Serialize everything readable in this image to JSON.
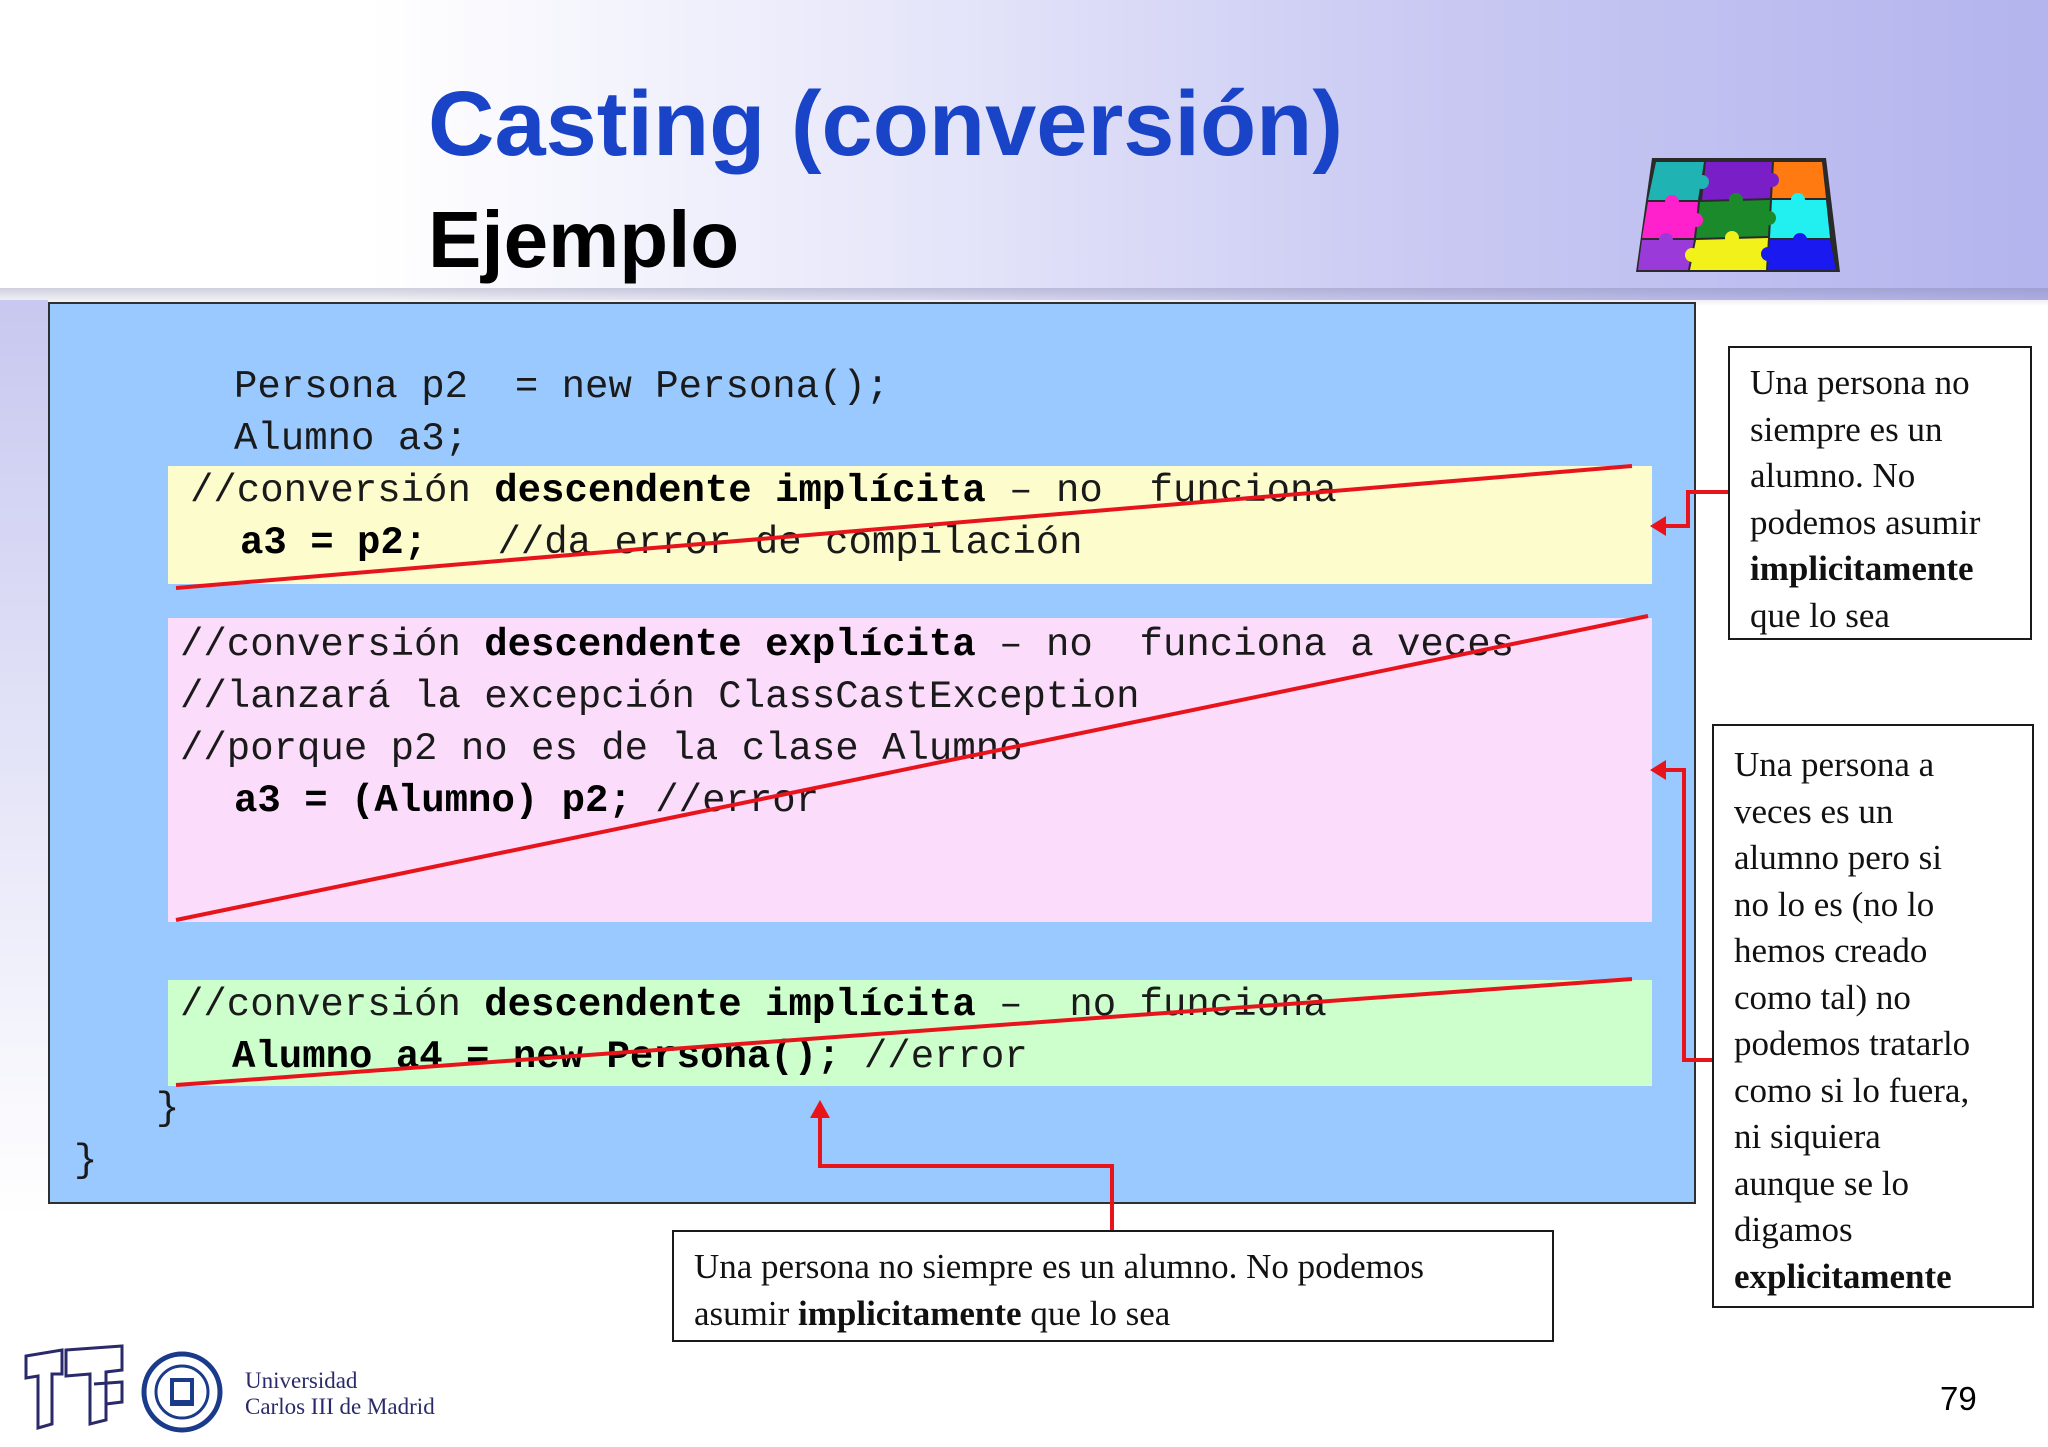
{
  "slide": {
    "title": "Casting (conversión)",
    "subtitle": "Ejemplo",
    "page_number": "79"
  },
  "code": {
    "lines": [
      {
        "id": "l1",
        "parts": [
          {
            "t": "Persona p2  = new Persona();",
            "b": false
          }
        ]
      },
      {
        "id": "l2",
        "parts": [
          {
            "t": "Alumno a3;",
            "b": false
          }
        ]
      },
      {
        "id": "l3",
        "parts": [
          {
            "t": "//conversión ",
            "b": false
          },
          {
            "t": "descendente implícita",
            "b": true
          },
          {
            "t": " – no  funciona",
            "b": false
          }
        ]
      },
      {
        "id": "l4",
        "parts": [
          {
            "t": "a3 = p2;",
            "b": true
          },
          {
            "t": "   //da error de compilación",
            "b": false
          }
        ]
      },
      {
        "id": "l5",
        "parts": [
          {
            "t": "//conversión ",
            "b": false
          },
          {
            "t": "descendente explícita",
            "b": true
          },
          {
            "t": " – no  funciona a veces",
            "b": false
          }
        ]
      },
      {
        "id": "l6",
        "parts": [
          {
            "t": "//lanzará la excepción ClassCastException",
            "b": false
          }
        ]
      },
      {
        "id": "l7",
        "parts": [
          {
            "t": "//porque p2 no es de la clase Alumno",
            "b": false
          }
        ]
      },
      {
        "id": "l8",
        "parts": [
          {
            "t": "a3 = (Alumno) p2;",
            "b": true
          },
          {
            "t": " //error",
            "b": false
          }
        ]
      },
      {
        "id": "l9",
        "parts": [
          {
            "t": "//conversión ",
            "b": false
          },
          {
            "t": "descendente implícita",
            "b": true
          },
          {
            "t": " –  no funciona",
            "b": false
          }
        ]
      },
      {
        "id": "l10",
        "parts": [
          {
            "t": "Alumno a4 = new Persona();",
            "b": true
          },
          {
            "t": " //error",
            "b": false
          }
        ]
      },
      {
        "id": "l11",
        "parts": [
          {
            "t": "}",
            "b": false
          }
        ]
      },
      {
        "id": "l12",
        "parts": [
          {
            "t": "}",
            "b": false
          }
        ]
      }
    ]
  },
  "callouts": {
    "right_top": {
      "lines": [
        [
          {
            "t": "Una persona no",
            "b": false
          }
        ],
        [
          {
            "t": "siempre es un",
            "b": false
          }
        ],
        [
          {
            "t": "alumno. No",
            "b": false
          }
        ],
        [
          {
            "t": "podemos asumir",
            "b": false
          }
        ],
        [
          {
            "t": "implicitamente",
            "b": true
          }
        ],
        [
          {
            "t": "que lo sea",
            "b": false
          }
        ]
      ]
    },
    "right_bottom": {
      "lines": [
        [
          {
            "t": "Una persona  a",
            "b": false
          }
        ],
        [
          {
            "t": "veces es un",
            "b": false
          }
        ],
        [
          {
            "t": "alumno pero si",
            "b": false
          }
        ],
        [
          {
            "t": "no lo es (no lo",
            "b": false
          }
        ],
        [
          {
            "t": "hemos creado",
            "b": false
          }
        ],
        [
          {
            "t": "como tal) no",
            "b": false
          }
        ],
        [
          {
            "t": "podemos tratarlo",
            "b": false
          }
        ],
        [
          {
            "t": "como si lo fuera,",
            "b": false
          }
        ],
        [
          {
            "t": "ni siquiera",
            "b": false
          }
        ],
        [
          {
            "t": "aunque se lo",
            "b": false
          }
        ],
        [
          {
            "t": "digamos",
            "b": false
          }
        ],
        [
          {
            "t": "explicitamente",
            "b": true
          }
        ]
      ]
    },
    "bottom": {
      "lines": [
        [
          {
            "t": "Una persona no siempre es un alumno. No podemos",
            "b": false
          }
        ],
        [
          {
            "t": "asumir ",
            "b": false
          },
          {
            "t": "implicitamente",
            "b": true
          },
          {
            "t": " que lo sea",
            "b": false
          }
        ]
      ]
    }
  },
  "logo": {
    "university_line1": "Universidad",
    "university_line2": "Carlos III de Madrid"
  },
  "colors": {
    "title": "#1a44c8",
    "code_panel": "#99c9ff",
    "highlight_yellow": "#fcfccc",
    "highlight_pink": "#fbdcfb",
    "highlight_green": "#ccffcc",
    "strike_red": "#e8141c"
  }
}
